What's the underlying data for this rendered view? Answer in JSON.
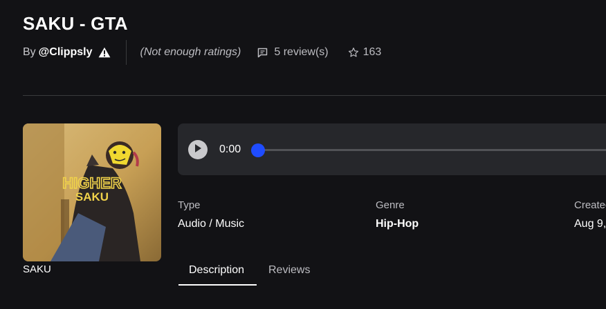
{
  "asset": {
    "title": "SAKU - GTA",
    "by_label": "By",
    "creator": "@Clippsly",
    "rating_text": "(Not enough ratings)",
    "review_count": "5 review(s)",
    "favorites": "163"
  },
  "thumbnail": {
    "caption": "SAKU",
    "art_text_top": "HIGHER",
    "art_text_bottom": "SAKU"
  },
  "player": {
    "time": "0:00",
    "progress": 0,
    "accent_color": "#1f4cff"
  },
  "details": [
    {
      "label": "Type",
      "value": "Audio / Music"
    },
    {
      "label": "Genre",
      "value": "Hip-Hop"
    },
    {
      "label": "Created",
      "value": "Aug 9,"
    }
  ],
  "tabs": [
    {
      "label": "Description",
      "active": true
    },
    {
      "label": "Reviews",
      "active": false
    }
  ],
  "icons": {
    "warning": "warning-icon",
    "review": "comment-icon",
    "favorite": "star-icon",
    "play": "play-icon"
  }
}
